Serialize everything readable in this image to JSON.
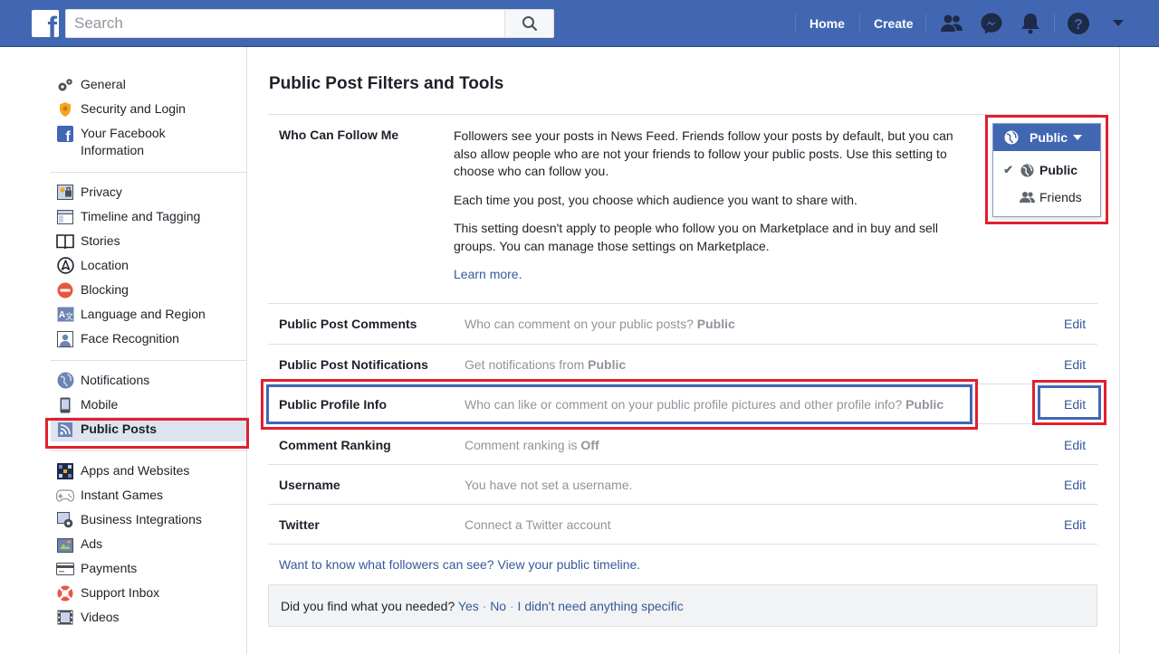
{
  "topbar": {
    "logo": "f",
    "search_placeholder": "Search",
    "home": "Home",
    "create": "Create"
  },
  "sidebar": {
    "groups": [
      [
        {
          "label": "General",
          "icon": "gear-icon"
        },
        {
          "label": "Security and Login",
          "icon": "badge-icon"
        },
        {
          "label": "Your Facebook Information",
          "icon": "facebook-icon"
        }
      ],
      [
        {
          "label": "Privacy",
          "icon": "lock-icon"
        },
        {
          "label": "Timeline and Tagging",
          "icon": "timeline-icon"
        },
        {
          "label": "Stories",
          "icon": "book-icon"
        },
        {
          "label": "Location",
          "icon": "location-icon"
        },
        {
          "label": "Blocking",
          "icon": "blocking-icon"
        },
        {
          "label": "Language and Region",
          "icon": "language-icon"
        },
        {
          "label": "Face Recognition",
          "icon": "face-icon"
        }
      ],
      [
        {
          "label": "Notifications",
          "icon": "globe-icon"
        },
        {
          "label": "Mobile",
          "icon": "mobile-icon"
        },
        {
          "label": "Public Posts",
          "icon": "rss-icon",
          "active": true
        }
      ],
      [
        {
          "label": "Apps and Websites",
          "icon": "apps-icon"
        },
        {
          "label": "Instant Games",
          "icon": "gamepad-icon"
        },
        {
          "label": "Business Integrations",
          "icon": "business-icon"
        },
        {
          "label": "Ads",
          "icon": "ads-icon"
        },
        {
          "label": "Payments",
          "icon": "card-icon"
        },
        {
          "label": "Support Inbox",
          "icon": "lifebuoy-icon"
        },
        {
          "label": "Videos",
          "icon": "video-icon"
        }
      ]
    ]
  },
  "main": {
    "title": "Public Post Filters and Tools",
    "follow": {
      "label": "Who Can Follow Me",
      "p1": "Followers see your posts in News Feed. Friends follow your posts by default, but you can also allow people who are not your friends to follow your public posts. Use this setting to choose who can follow you.",
      "p2": "Each time you post, you choose which audience you want to share with.",
      "p3": "This setting doesn't apply to people who follow you on Marketplace and in buy and sell groups. You can manage those settings on Marketplace.",
      "learn_more": "Learn more."
    },
    "audience": {
      "selected": "Public",
      "options": [
        {
          "label": "Public",
          "checked": true
        },
        {
          "label": "Friends",
          "checked": false
        }
      ]
    },
    "rows": [
      {
        "label": "Public Post Comments",
        "value": "Who can comment on your public posts?",
        "value_bold": "Public",
        "edit": "Edit"
      },
      {
        "label": "Public Post Notifications",
        "value": "Get notifications from",
        "value_bold": "Public",
        "edit": "Edit"
      },
      {
        "label": "Public Profile Info",
        "value": "Who can like or comment on your public profile pictures and other profile info?",
        "value_bold": "Public",
        "edit": "Edit"
      },
      {
        "label": "Comment Ranking",
        "value": "Comment ranking is",
        "value_bold": "Off",
        "edit": "Edit"
      },
      {
        "label": "Username",
        "value": "You have not set a username.",
        "value_bold": "",
        "edit": "Edit"
      },
      {
        "label": "Twitter",
        "value": "Connect a Twitter account",
        "value_bold": "",
        "edit": "Edit"
      }
    ],
    "timeline_link": "Want to know what followers can see? View your public timeline.",
    "feedback": {
      "question": "Did you find what you needed?",
      "yes": "Yes",
      "no": "No",
      "nothing": "I didn't need anything specific",
      "separator": "·"
    }
  },
  "colors": {
    "brand": "#4267b2",
    "link": "#365899",
    "highlight": "#e0202e"
  }
}
